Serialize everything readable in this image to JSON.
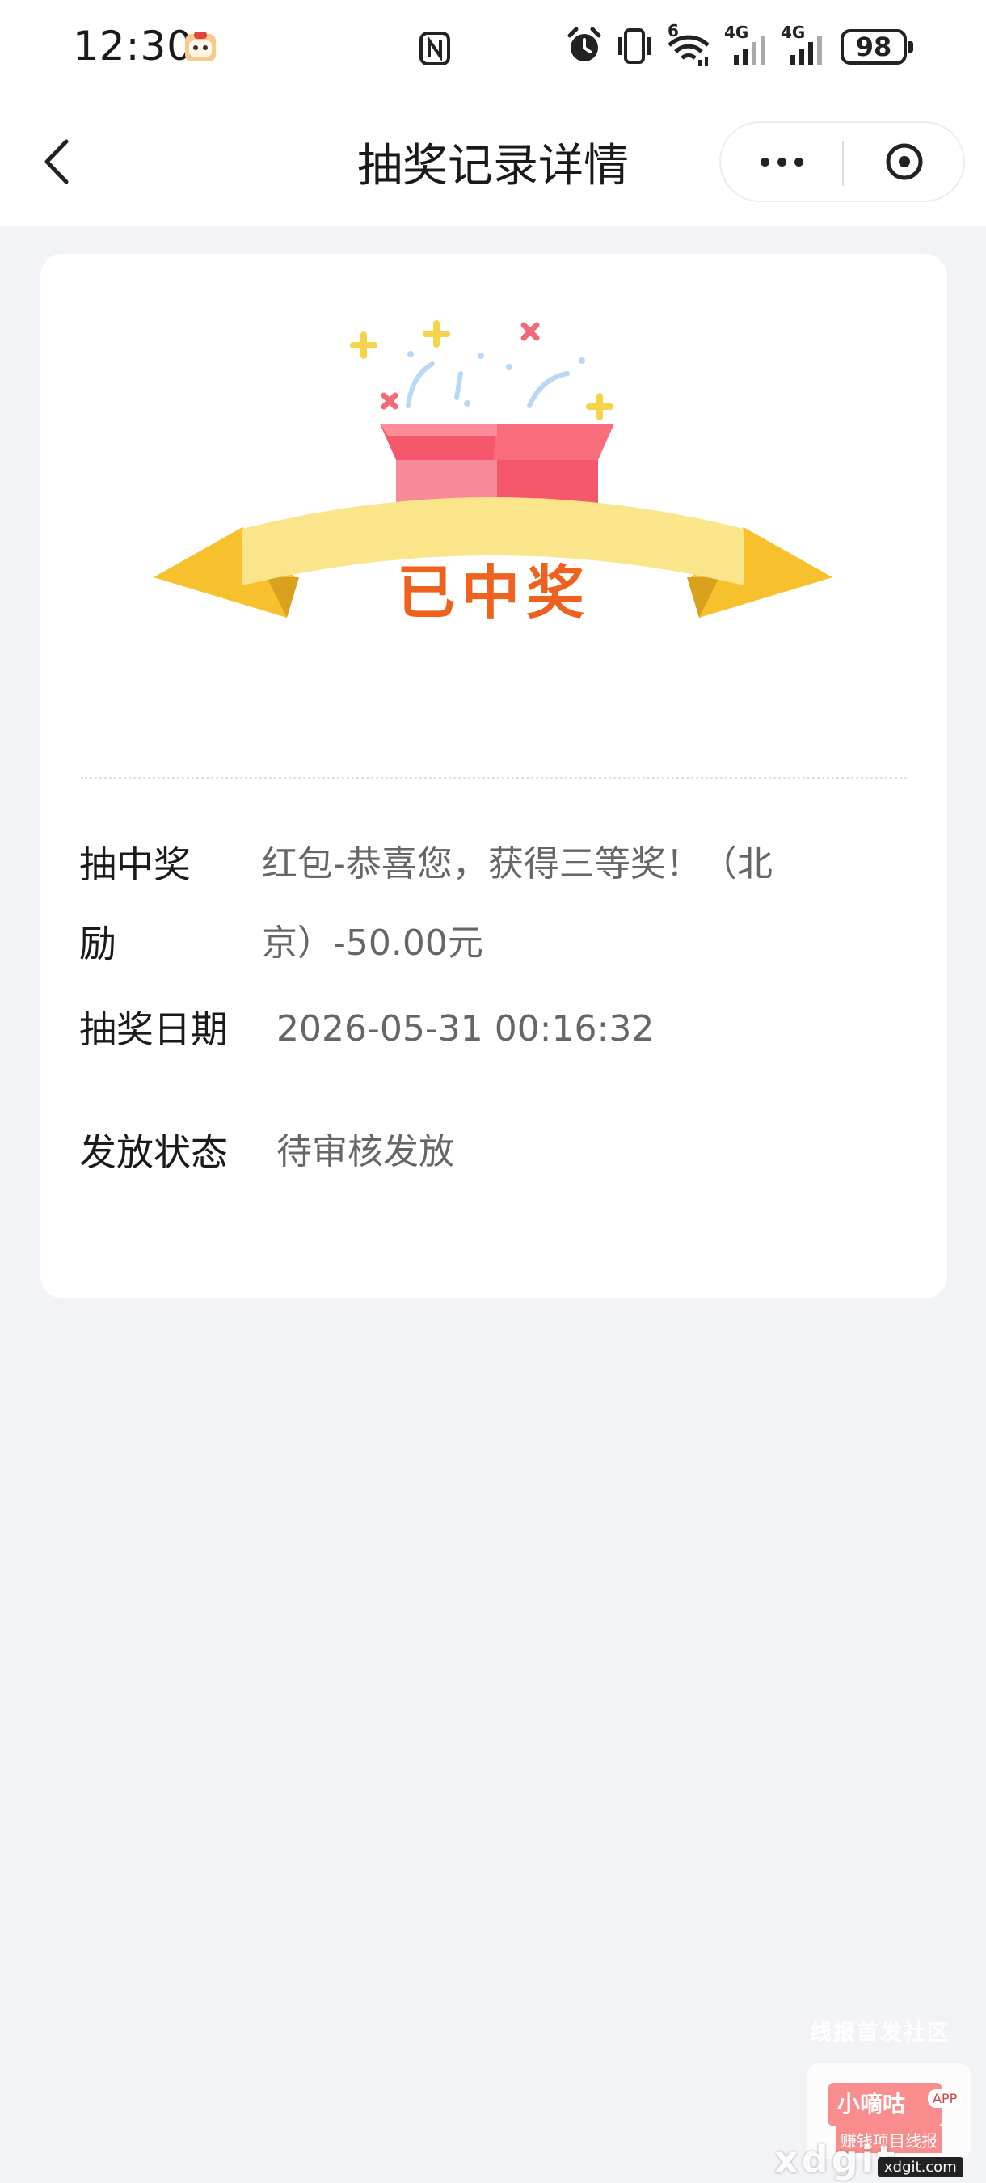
{
  "status_bar": {
    "time": "12:30",
    "network_6": "6",
    "network_4g_1": "4G",
    "network_4g_2": "4G",
    "battery": "98"
  },
  "nav": {
    "title": "抽奖记录详情"
  },
  "banner": {
    "text": "已中奖"
  },
  "details": {
    "prize_label": "抽中奖励",
    "prize_value": "红包-恭喜您，获得三等奖！（北京）-50.00元",
    "date_label": "抽奖日期",
    "date_value": "2026-05-31 00:16:32",
    "status_label": "发放状态",
    "status_value": "待审核发放"
  },
  "watermark": {
    "top": "线报首发社区",
    "brand": "小嘀咕",
    "app": "APP",
    "slogan": "赚钱项目线报",
    "domain": "xdgit",
    "domain_small": "xdgit.com"
  },
  "colors": {
    "background": "#f2f3f6",
    "card": "#ffffff",
    "banner_text": "#f0611f",
    "ribbon": "#fbe58a",
    "ribbon_tail": "#f7c12e",
    "gift_box": "#f4566a"
  }
}
